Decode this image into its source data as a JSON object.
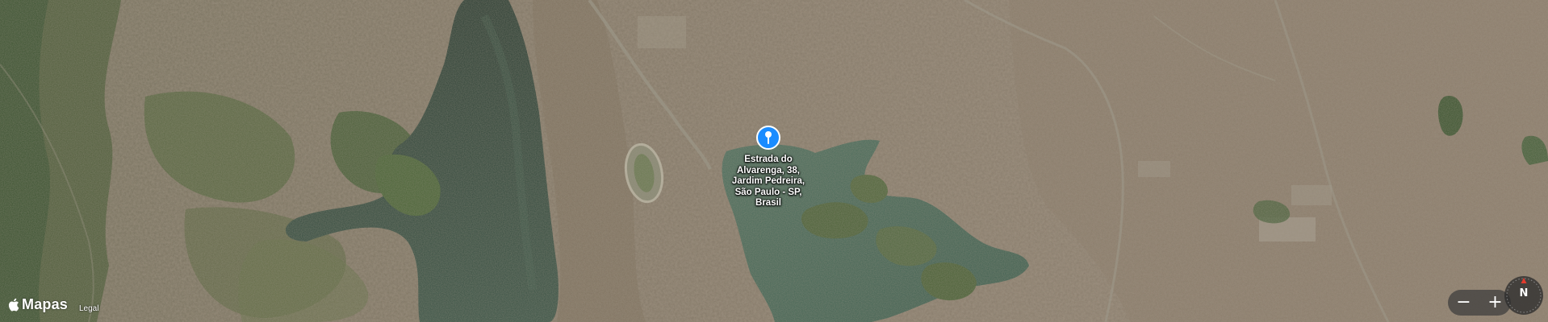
{
  "map": {
    "type": "satellite",
    "location": "São Paulo"
  },
  "pin": {
    "label": "Estrada do\nAlvarenga, 38,\nJardim Pedreira,\nSão Paulo - SP,\nBrasil",
    "color": "#1a8cff"
  },
  "attribution": {
    "brand": "Mapas",
    "legal": "Legal"
  },
  "controls": {
    "zoom_out": "−",
    "zoom_in": "+",
    "compass": "N"
  },
  "colors": {
    "water": "#2f4a3e",
    "water_light": "#5e806c",
    "urban": "#8a7c68",
    "vegetation": "#3f5a2e",
    "compass_needle": "#e23b2e"
  }
}
